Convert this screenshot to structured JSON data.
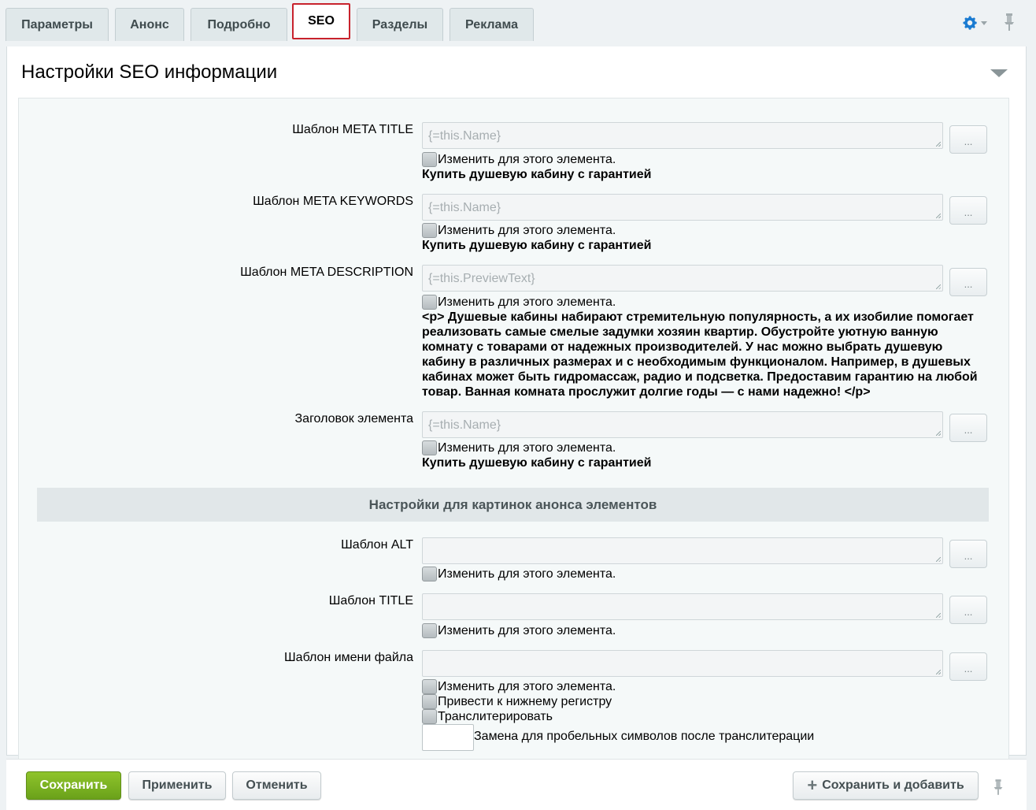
{
  "tabs": {
    "params": "Параметры",
    "announce": "Анонс",
    "detail": "Подробно",
    "seo": "SEO",
    "sections": "Разделы",
    "ads": "Реклама"
  },
  "panel": {
    "title": "Настройки SEO информации"
  },
  "fields": {
    "meta_title": {
      "label": "Шаблон META TITLE",
      "placeholder": "{=this.Name}",
      "change_label": "Изменить для этого элемента.",
      "value": "Купить душевую кабину с гарантией"
    },
    "meta_keywords": {
      "label": "Шаблон META KEYWORDS",
      "placeholder": "{=this.Name}",
      "change_label": "Изменить для этого элемента.",
      "value": "Купить душевую кабину с гарантией"
    },
    "meta_description": {
      "label": "Шаблон META DESCRIPTION",
      "placeholder": "{=this.PreviewText}",
      "change_label": "Изменить для этого элемента.",
      "value": "<p> Душевые кабины набирают стремительную популярность, а их изобилие помогает реализовать самые смелые задумки хозяин квартир. Обустройте уютную ванную комнату с товарами от надежных производителей. У нас можно выбрать душевую кабину в различных размерах и с необходимым функционалом. Например, в душевых кабинах может быть гидромассаж, радио и подсветка. Предоставим гарантию на любой товар. Ванная комната прослужит долгие годы — с нами надежно! </p>"
    },
    "element_title": {
      "label": "Заголовок элемента",
      "placeholder": "{=this.Name}",
      "change_label": "Изменить для этого элемента.",
      "value": "Купить душевую кабину с гарантией"
    },
    "section_header": "Настройки для картинок анонса элементов",
    "alt": {
      "label": "Шаблон ALT",
      "change_label": "Изменить для этого элемента."
    },
    "img_title": {
      "label": "Шаблон TITLE",
      "change_label": "Изменить для этого элемента."
    },
    "file_name": {
      "label": "Шаблон имени файла",
      "change_label": "Изменить для этого элемента.",
      "lowercase_label": "Привести к нижнему регистру",
      "translit_label": "Транслитерировать",
      "space_replace_label": "Замена для пробельных символов после транслитерации"
    },
    "dots_label": "..."
  },
  "footer": {
    "save": "Сохранить",
    "apply": "Применить",
    "cancel": "Отменить",
    "save_add": "Сохранить и добавить"
  },
  "colors": {
    "active_tab_border": "#c8222c",
    "save_button": "#7ab221",
    "gear_icon": "#1a7bd1"
  }
}
